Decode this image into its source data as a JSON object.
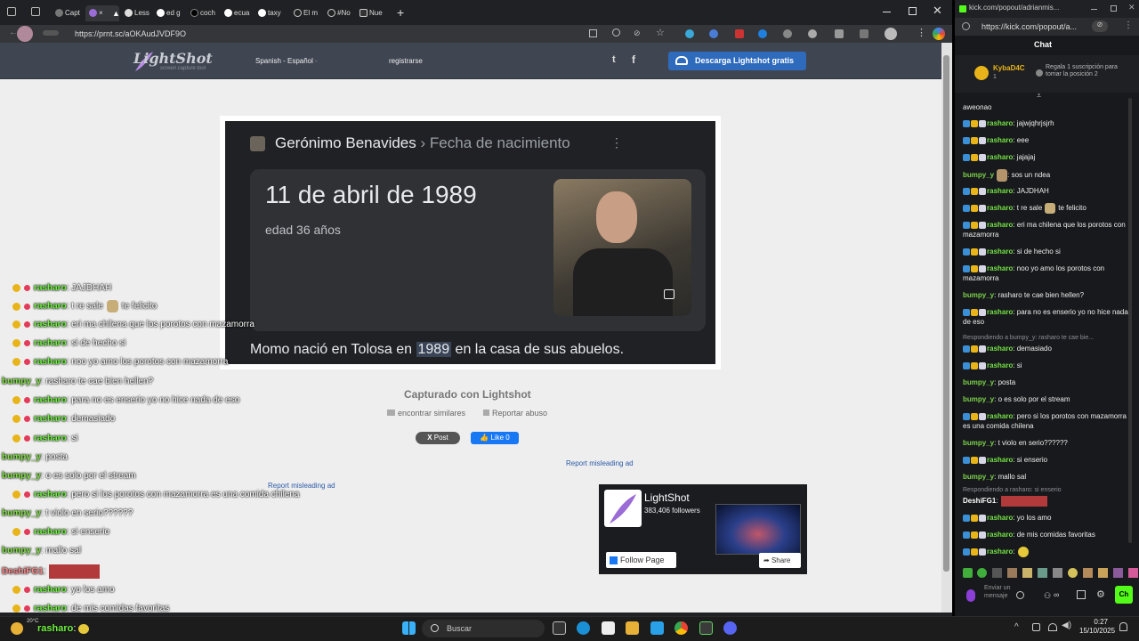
{
  "tabs": [
    {
      "label": "Capt"
    },
    {
      "label": "×"
    },
    {
      "label": "Less"
    },
    {
      "label": "ed g"
    },
    {
      "label": "coch"
    },
    {
      "label": "ecua"
    },
    {
      "label": "taxy"
    },
    {
      "label": "El m"
    },
    {
      "label": "#No"
    },
    {
      "label": "Nue"
    }
  ],
  "address": {
    "url": "https://prnt.sc/aOKAudJVDF9O"
  },
  "lightshot": {
    "logo": "LightShot",
    "logo_sub": "screen capture tool",
    "lang": "Spanish - Español",
    "register": "registrarse",
    "download": "Descarga Lightshot gratis",
    "captured": "Capturado con Lightshot",
    "find_similar": "encontrar similares",
    "report": "Reportar abuso",
    "post": "Post",
    "like": "Like 0",
    "misleading_ad": "Report misleading ad",
    "misleading_ad2": "Report misleading ad",
    "fb_name": "LightShot",
    "fb_followers": "383,406 followers",
    "fb_follow": "Follow Page",
    "fb_share": "Share"
  },
  "google": {
    "person": "Gerónimo Benavides",
    "sep": "›",
    "attr": "Fecha de nacimiento",
    "date": "11 de abril de 1989",
    "age": "edad 36 años",
    "caption_pre": "Momo nació en Tolosa en",
    "caption_year": "1989",
    "caption_post": "en la casa de sus abuelos."
  },
  "overlay_chat": [
    {
      "user": "rasharo",
      "text": ": JAJDHAH"
    },
    {
      "user": "rasharo",
      "text": ": t re sale",
      "text2": "te felicito"
    },
    {
      "user": "rasharo",
      "text": ": eri ma chilena que los porotos con mazamorra"
    },
    {
      "user": "rasharo",
      "text": ": si de hecho si"
    },
    {
      "user": "rasharo",
      "text": ": noo yo amo los porotos con mazamorra"
    },
    {
      "user": "bumpy_y",
      "text": ": rasharo te cae bien hellen?"
    },
    {
      "user": "rasharo",
      "text": ": para no es enserio yo no hice nada de eso"
    },
    {
      "user": "rasharo",
      "text": ": demasiado"
    },
    {
      "user": "rasharo",
      "text": ": si"
    },
    {
      "user": "bumpy_y",
      "text": ": posta"
    },
    {
      "user": "bumpy_y",
      "text": ": o es solo por el stream"
    },
    {
      "user": "rasharo",
      "text": ": pero si los porotos con mazamorra es una comida chilena"
    },
    {
      "user": "bumpy_y",
      "text": ": t violo en serio??????"
    },
    {
      "user": "rasharo",
      "text": ": si enserio"
    },
    {
      "user": "bumpy_y",
      "text": ": mallo sal"
    },
    {
      "user": "DeshiFG1",
      "text": ":"
    },
    {
      "user": "rasharo",
      "text": ": yo los amo"
    },
    {
      "user": "rasharo",
      "text": ": de mis comidas favoritas"
    },
    {
      "user": "rasharo",
      "text": ":"
    }
  ],
  "kick": {
    "url_tab": "kick.com/popout/adrianmis...",
    "url": "https://kick.com/popout/a...",
    "chat_title": "Chat",
    "pinned_user": "KybaD4C",
    "pinned_count": "1",
    "pinned_text": "Regala 1 suscripción para tomar la posición 2",
    "first_line": "aweonao",
    "messages": [
      {
        "user": "rasharo",
        "text": ": jajwjqhrjsjrh"
      },
      {
        "user": "rasharo",
        "text": ": eee"
      },
      {
        "user": "rasharo",
        "text": ": jajajaj"
      },
      {
        "user": "bumpy_y",
        "text": ": sos un ndea"
      },
      {
        "user": "rasharo",
        "text": ": JAJDHAH"
      },
      {
        "user": "rasharo",
        "text": ": t re sale",
        "text2": "te felicito"
      },
      {
        "user": "rasharo",
        "text": ": eri ma chilena que los porotos con mazamorra"
      },
      {
        "user": "rasharo",
        "text": ": si de hecho si"
      },
      {
        "user": "rasharo",
        "text": ": noo yo amo los porotos con mazamorra"
      },
      {
        "user": "bumpy_y",
        "text": ": rasharo te cae bien hellen?"
      },
      {
        "user": "rasharo",
        "text": ": para no es enserio yo no hice nada de eso"
      },
      {
        "user": "rasharo",
        "text": ": demasiado"
      },
      {
        "user": "rasharo",
        "text": ": si"
      },
      {
        "user": "bumpy_y",
        "text": ": posta"
      },
      {
        "user": "bumpy_y",
        "text": ": o es solo por el stream"
      },
      {
        "user": "rasharo",
        "text": ": pero si los porotos con mazamorra es una comida chilena"
      },
      {
        "user": "bumpy_y",
        "text": ": t violo en serio??????"
      },
      {
        "user": "rasharo",
        "text": ": si enserio"
      },
      {
        "user": "bumpy_y",
        "text": ": mallo sal"
      },
      {
        "user": "DeshiFG1",
        "text": ":"
      },
      {
        "user": "rasharo",
        "text": ": yo los amo"
      },
      {
        "user": "rasharo",
        "text": ": de mis comidas favoritas"
      },
      {
        "user": "rasharo",
        "text": ":"
      }
    ],
    "reply1": "Respondiendo a bumpy_y: rasharo te cae bie...",
    "reply2": "Respondiendo a rasharo: si enserio",
    "send_placeholder": "Enviar un mensaje",
    "send": "Ch"
  },
  "taskbar": {
    "search": "Buscar",
    "temp": "20°C",
    "time": "0:27",
    "date": "15/10/2025",
    "overlay_user": "rasharo",
    "overlay_text": ":"
  },
  "colors": {
    "accent": "#2f6bbd",
    "kick_green": "#53fc18",
    "user_green": "#73e344"
  }
}
